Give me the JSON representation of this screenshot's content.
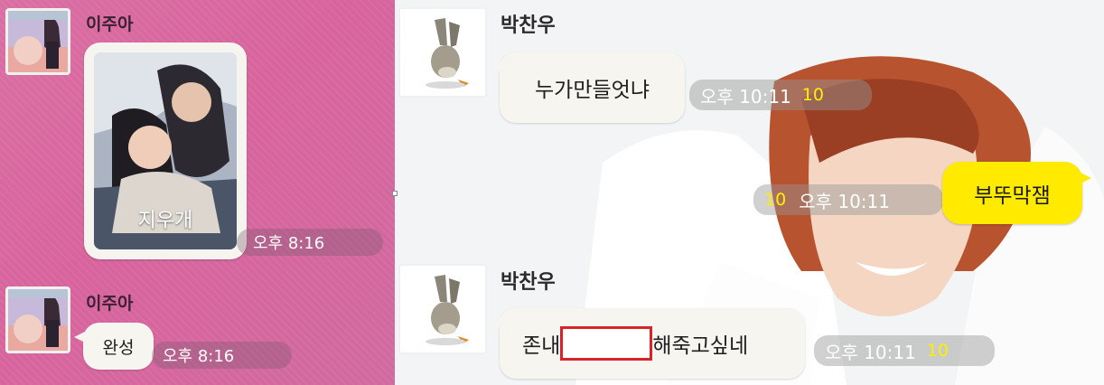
{
  "left_chat": {
    "messages": [
      {
        "sender": "이주아",
        "type": "image",
        "poster_title": "지우개",
        "time": "오후 8:16"
      },
      {
        "sender": "이주아",
        "type": "text",
        "text": "완성",
        "time": "오후 8:16"
      }
    ]
  },
  "right_chat": {
    "messages": [
      {
        "sender": "박찬우",
        "type": "text",
        "text": "누가만들엇냐",
        "time": "오후 10:11",
        "unread": "10"
      },
      {
        "sender": "",
        "type": "text",
        "text": "부뚜막잼",
        "time": "오후 10:11",
        "unread": "10",
        "mine": true
      },
      {
        "sender": "박찬우",
        "type": "text",
        "text_before": "존내",
        "text_after": "해죽고싶네",
        "time": "오후 10:11",
        "unread": "10"
      }
    ]
  },
  "colors": {
    "left_bg": "#d96fa3",
    "my_bubble": "#ffea00",
    "unread_count": "#ffee00",
    "redaction_box": "#d9232b"
  },
  "icons": {
    "avatar_left": "girl-profile-photo",
    "avatar_right": "rabbit-character-photo"
  }
}
